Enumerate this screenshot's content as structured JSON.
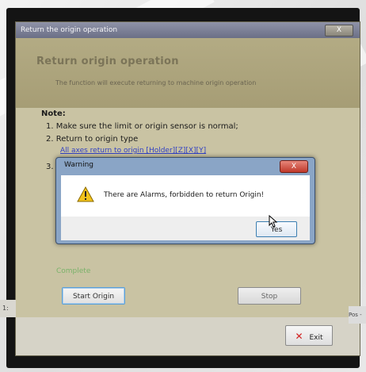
{
  "main_window": {
    "title": "Return the origin operation",
    "close_label": "X",
    "header_title": "Return origin operation",
    "header_description": "The function will execute returning to machine origin operation",
    "note_title": "Note:",
    "note_items": [
      "1. Make sure the limit or origin sensor is normal;",
      "2. Return to origin type",
      "3."
    ],
    "note_link": "All axes return to origin [Holder][Z][X][Y]",
    "status_text": "Complete",
    "start_button": "Start Origin",
    "stop_button": "Stop",
    "exit_button": "Exit"
  },
  "warning_dialog": {
    "title": "Warning",
    "close_label": "X",
    "message": "There are Alarms,  forbidden to return Origin!",
    "yes_button": "Yes",
    "icon": "warning-triangle-icon"
  },
  "background_fragments": {
    "left_text": "1:",
    "right_text": "Pos -"
  },
  "colors": {
    "dialog_background": "#c9c3a3",
    "link_blue": "#2f3fc4",
    "complete_green": "#7ab26a",
    "exit_icon_red": "#d21f1f",
    "warning_frame": "#8aa5c6"
  }
}
